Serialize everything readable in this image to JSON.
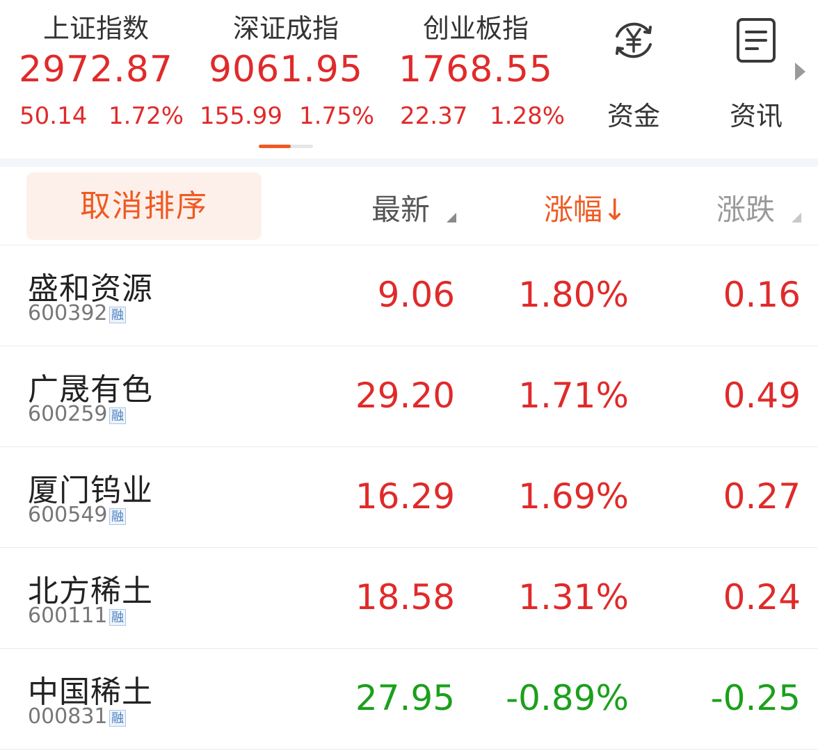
{
  "indices": [
    {
      "name": "上证指数",
      "value": "2972.87",
      "change": "50.14",
      "pct": "1.72%"
    },
    {
      "name": "深证成指",
      "value": "9061.95",
      "change": "155.99",
      "pct": "1.75%"
    },
    {
      "name": "创业板指",
      "value": "1768.55",
      "change": "22.37",
      "pct": "1.28%"
    }
  ],
  "shortcuts": {
    "funds": {
      "label": "资金",
      "icon": "yuan-cycle-icon"
    },
    "news": {
      "label": "资讯",
      "icon": "document-icon"
    }
  },
  "pager": {
    "pages": 2,
    "active": 1
  },
  "header": {
    "cancel_sort": "取消排序",
    "latest": "最新",
    "pct": "涨幅↓",
    "change": "涨跌"
  },
  "stocks": [
    {
      "name": "盛和资源",
      "code": "600392",
      "tag": "融",
      "latest": "9.06",
      "pct": "1.80%",
      "change": "0.16",
      "direction": "up"
    },
    {
      "name": "广晟有色",
      "code": "600259",
      "tag": "融",
      "latest": "29.20",
      "pct": "1.71%",
      "change": "0.49",
      "direction": "up"
    },
    {
      "name": "厦门钨业",
      "code": "600549",
      "tag": "融",
      "latest": "16.29",
      "pct": "1.69%",
      "change": "0.27",
      "direction": "up"
    },
    {
      "name": "北方稀土",
      "code": "600111",
      "tag": "融",
      "latest": "18.58",
      "pct": "1.31%",
      "change": "0.24",
      "direction": "up"
    },
    {
      "name": "中国稀土",
      "code": "000831",
      "tag": "融",
      "latest": "27.95",
      "pct": "-0.89%",
      "change": "-0.25",
      "direction": "down"
    }
  ],
  "colors": {
    "up": "#e02a2a",
    "down": "#1ba01b",
    "accent": "#ef5a23"
  }
}
